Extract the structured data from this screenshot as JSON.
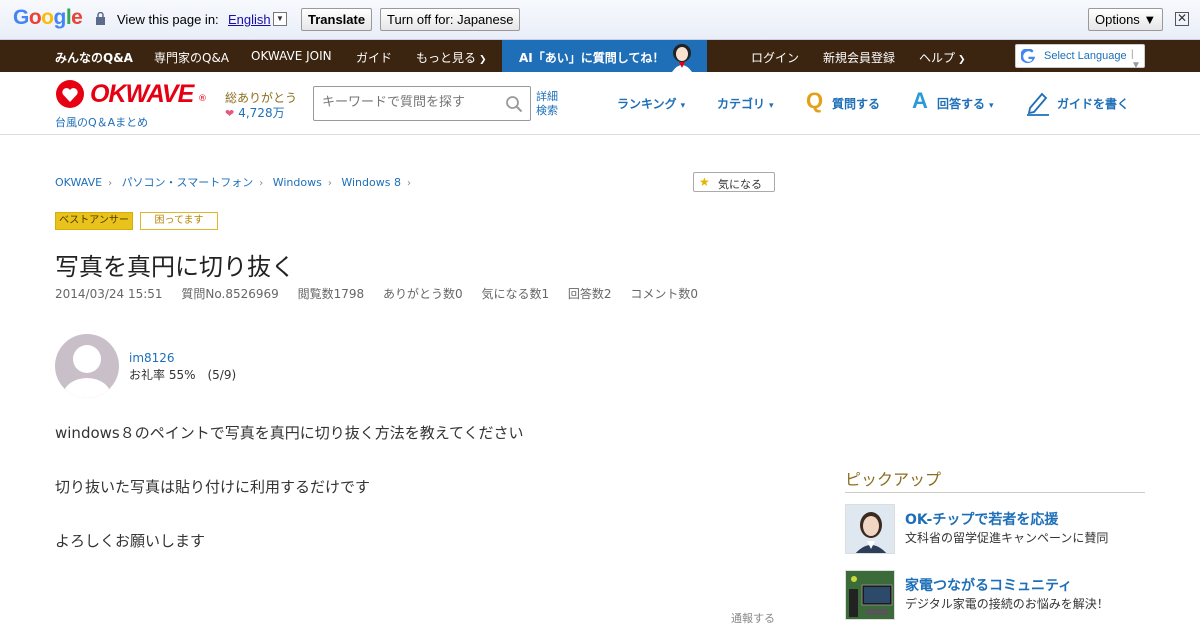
{
  "translate_bar": {
    "logo": "Google",
    "view_text": "View this page in:",
    "language": "English",
    "translate_label": "Translate",
    "turn_off_label": "Turn off for: Japanese",
    "options_label": "Options ▼",
    "close": "✕"
  },
  "topnav": {
    "items": [
      "みんなのQ&A",
      "専門家のQ&A",
      "OKWAVE JOIN",
      "ガイド",
      "もっと見る"
    ],
    "ai_banner": "AI「あい」に質問してね！",
    "right_items": [
      "ログイン",
      "新規会員登録",
      "ヘルプ"
    ],
    "select_language": "Select Language"
  },
  "header": {
    "logo": "OKWAVE",
    "reg_mark": "®",
    "typhoon_link": "台風のQ＆Aまとめ",
    "thanks_label": "総ありがとう",
    "thanks_count": "4,728万",
    "search_placeholder": "キーワードで質問を探す",
    "advanced_search_1": "詳細",
    "advanced_search_2": "検索",
    "ranking": "ランキング",
    "category": "カテゴリ",
    "ask": "質問する",
    "answer": "回答する",
    "write_guide": "ガイドを書く",
    "q_mark": "Q",
    "a_mark": "A"
  },
  "breadcrumb": [
    "OKWAVE",
    "パソコン・スマートフォン",
    "Windows",
    "Windows 8"
  ],
  "kininaru_button": "気になる",
  "badges": {
    "best_answer": "ベストアンサー",
    "trouble": "困ってます"
  },
  "question": {
    "title": "写真を真円に切り抜く",
    "date": "2014/03/24 15:51",
    "number": "質問No.8526969",
    "views": "閲覧数1798",
    "thanks": "ありがとう数0",
    "kininaru": "気になる数1",
    "answers": "回答数2",
    "comments": "コメント数0",
    "user": "im8126",
    "rate": "お礼率 55%　(5/9)",
    "body": [
      "windows８のペイントで写真を真円に切り抜く方法を教えてください",
      "切り抜いた写真は貼り付けに利用するだけです",
      "よろしくお願いします"
    ],
    "report": "通報する"
  },
  "pickup": {
    "title": "ピックアップ",
    "items": [
      {
        "title": "OK-チップで若者を応援",
        "sub": "文科省の留学促進キャンペーンに賛同"
      },
      {
        "title": "家電つながるコミュニティ",
        "sub": "デジタル家電の接続のお悩みを解決！"
      }
    ]
  },
  "colors": {
    "brand_red": "#e60012",
    "link_blue": "#1e6fb8",
    "nav_brown": "#3b2510",
    "best_answer_yellow": "#e9c31b"
  }
}
